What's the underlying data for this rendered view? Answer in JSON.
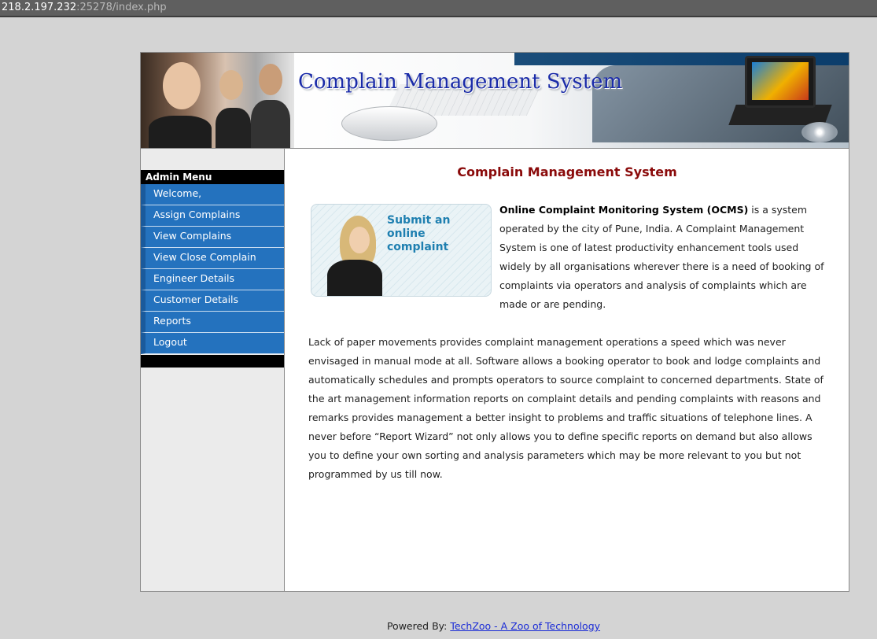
{
  "browser": {
    "url_host": "218.2.197.232",
    "url_rest": ":25278/index.php"
  },
  "header": {
    "banner_title": "Complain Management System"
  },
  "sidebar": {
    "heading": "Admin Menu",
    "items": [
      {
        "label": "Welcome,"
      },
      {
        "label": "Assign Complains"
      },
      {
        "label": "View Complains"
      },
      {
        "label": "View Close Complain"
      },
      {
        "label": "Engineer Details"
      },
      {
        "label": "Customer Details"
      },
      {
        "label": "Reports"
      },
      {
        "label": "Logout"
      }
    ]
  },
  "main": {
    "title": "Complain Management System",
    "promo_text": "Submit an online complaint",
    "intro_bold": "Online Complaint Monitoring System (OCMS)",
    "intro_rest": " is a system operated by the city of Pune, India. A Complaint Management System is one of latest productivity enhancement tools used widely by all organisations wherever there is a need of booking of complaints via operators and analysis of complaints which are made or are pending.",
    "paragraph": "Lack of paper movements provides complaint management operations a speed which was never envisaged in manual mode at all. Software allows a booking operator to book and lodge complaints and automatically schedules and prompts operators to source complaint to concerned departments. State of the art management information reports on complaint details and pending complaints with reasons and remarks provides management a better insight to problems and traffic situations of telephone lines. A never before “Report Wizard” not only allows you to define specific reports on demand but also allows you to define your own sorting and analysis parameters which may be more relevant to you but not programmed by us till now."
  },
  "footer": {
    "prefix": "Powered By: ",
    "link_text": "TechZoo - A Zoo of Technology"
  },
  "colors": {
    "menu_blue": "#2472be",
    "title_red": "#8a0a0a",
    "banner_title_blue": "#1a2ba8",
    "link_blue": "#1a2bd6"
  }
}
